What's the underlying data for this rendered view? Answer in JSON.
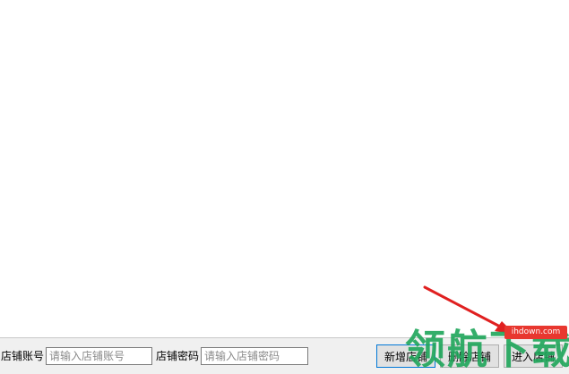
{
  "form": {
    "account_label": "店铺账号",
    "account_placeholder": "请输入店铺账号",
    "password_label": "店铺密码",
    "password_placeholder": "请输入店铺密码"
  },
  "buttons": {
    "add": "新增店铺",
    "delete": "删除店铺",
    "enter": "进入店铺"
  },
  "watermark": {
    "badge": "ihdown.com",
    "text": "领航下载"
  },
  "colors": {
    "bar_bg": "#f0f0f0",
    "arrow": "#e02020",
    "watermark_green": "#1fa65a",
    "badge_red": "#e8372f"
  }
}
